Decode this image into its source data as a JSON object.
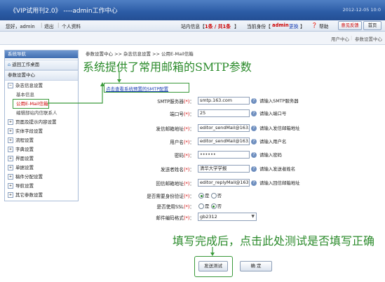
{
  "header": {
    "title": "《VIP试用刊2.0》 ----admin工作中心",
    "date": "2012-12-05 10:0"
  },
  "userbar": {
    "greeting": "您好，admin",
    "logout": "退出",
    "profile": "个人资料",
    "site_msg_prefix": "站内信息【",
    "site_msg_count": "1条 / 共1条",
    "site_msg_suffix": "】",
    "identity_prefix": "当前身份【",
    "identity_name": "admin",
    "identity_change": "更换",
    "identity_suffix": "】",
    "help": "帮助",
    "feedback": "意见反馈",
    "home": "首页"
  },
  "tabs": {
    "user_center": "用户中心",
    "param_center": "参数设置中心"
  },
  "sidebar": {
    "title": "系统导航",
    "items": [
      {
        "label": "返回工作桌面"
      },
      {
        "label": "参数设置中心"
      },
      {
        "label": "杂志信息设置"
      },
      {
        "label": "基本信息"
      },
      {
        "label": "公用E-Mail信箱"
      },
      {
        "label": "编辑部站内信联系人"
      },
      {
        "label": "页面及提示内容设置"
      },
      {
        "label": "实体字段设置"
      },
      {
        "label": "流程设置"
      },
      {
        "label": "字典设置"
      },
      {
        "label": "界面设置"
      },
      {
        "label": "单据设置"
      },
      {
        "label": "稿件分配设置"
      },
      {
        "label": "导航设置"
      },
      {
        "label": "其它参数设置"
      }
    ]
  },
  "breadcrumb": "参数设置中心 >> 杂志信息设置 >> 公用E-Mail信箱",
  "annotation_top": "系统提供了常用邮箱的SMTP参数",
  "annotation_bottom": "填写完成后，点击此处测试是否填写正确",
  "preset_link": "点击查看系统预置的SMTP配置",
  "form": {
    "smtp_server": {
      "label": "SMTP服务器",
      "value": "smtp.163.com",
      "hint": "请输入SMTP服务器"
    },
    "port": {
      "label": "端口号",
      "value": "25",
      "hint": "请输入端口号"
    },
    "sender_email": {
      "label": "发信邮箱地址",
      "value": "editor_sendMail@163.c",
      "hint": "请输入发信邮箱地址"
    },
    "username": {
      "label": "用户名",
      "value": "editor_sendMail@163.c",
      "hint": "请输入用户名"
    },
    "password": {
      "label": "密码",
      "value": "••••••",
      "hint": "请输入密码"
    },
    "sender_name": {
      "label": "发送者姓名",
      "value": "清华大学学报",
      "hint": "请输入发送者姓名"
    },
    "reply_email": {
      "label": "回信邮箱地址",
      "value": "editor_replyMail@163.c",
      "hint": "请输入回信邮箱地址"
    },
    "need_auth": {
      "label": "是否需要身份验证",
      "yes": "是",
      "no": "否",
      "selected": "是"
    },
    "use_ssl": {
      "label": "是否使用SSL",
      "yes": "是",
      "no": "否",
      "selected": "否"
    },
    "encoding": {
      "label": "邮件编码格式",
      "value": "gb2312"
    },
    "colon": "：",
    "required_mark": "(*)"
  },
  "buttons": {
    "test": "发送测试",
    "ok": "确 定"
  }
}
